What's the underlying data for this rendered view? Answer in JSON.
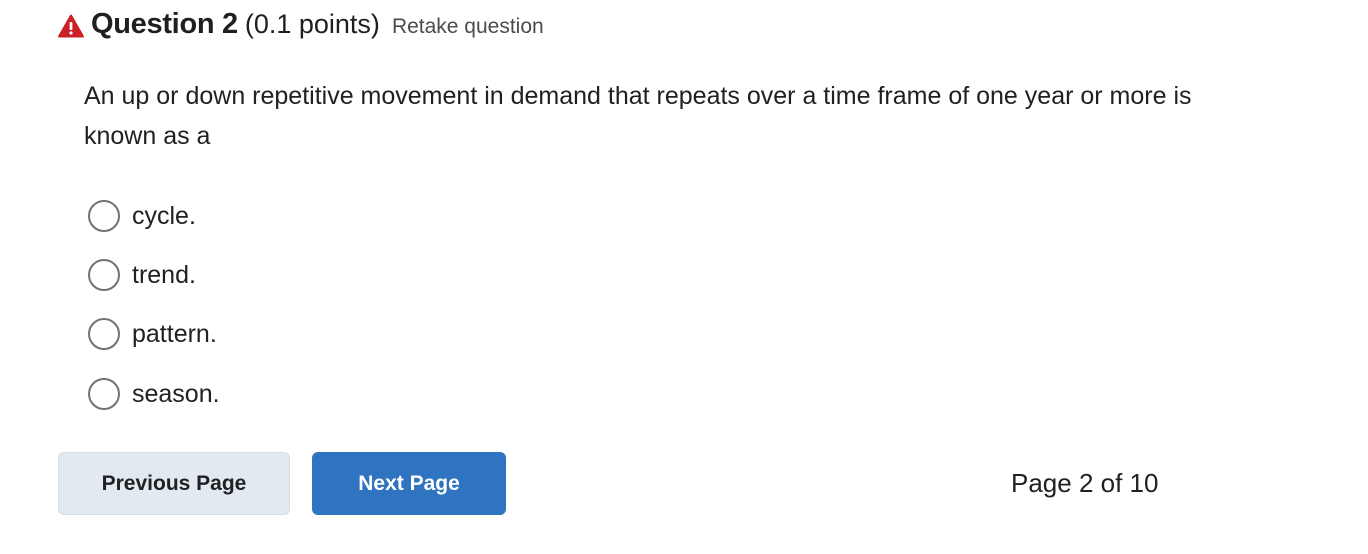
{
  "question": {
    "warning_icon": "warning-triangle-icon",
    "warning_color": "#cd2026",
    "title": "Question 2",
    "points": "(0.1 points)",
    "retake_label": "Retake question",
    "text": "An up or down repetitive movement in demand that repeats over a time frame of one year or more is known as a"
  },
  "options": [
    {
      "label": "cycle.",
      "selected": false
    },
    {
      "label": "trend.",
      "selected": false
    },
    {
      "label": "pattern.",
      "selected": false
    },
    {
      "label": "season.",
      "selected": false
    }
  ],
  "navigation": {
    "previous_label": "Previous Page",
    "next_label": "Next Page",
    "page_indicator": "Page 2 of 10",
    "next_button_color": "#2f74c0",
    "previous_button_color": "#e3e9f1"
  }
}
